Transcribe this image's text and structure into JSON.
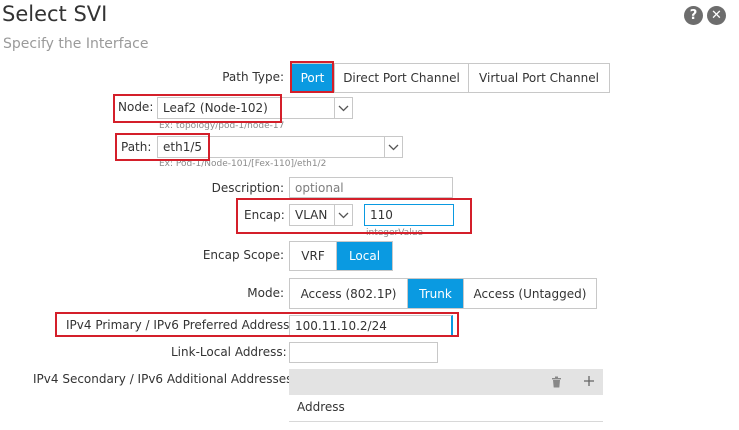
{
  "header": {
    "title": "Select SVI",
    "subtitle": "Specify the Interface",
    "help_glyph": "?",
    "close_glyph": "✕"
  },
  "form": {
    "path_type": {
      "label": "Path Type:",
      "options": [
        "Port",
        "Direct Port Channel",
        "Virtual Port Channel"
      ],
      "selected": "Port"
    },
    "node": {
      "label": "Node:",
      "value": "Leaf2 (Node-102)",
      "hint": "Ex: topology/pod-1/node-17"
    },
    "path": {
      "label": "Path:",
      "value": "eth1/5",
      "hint": "Ex: Pod-1/Node-101/[Fex-110]/eth1/2"
    },
    "description": {
      "label": "Description:",
      "placeholder": "optional"
    },
    "encap": {
      "label": "Encap:",
      "type": "VLAN",
      "value": "110",
      "hint": "integerValue"
    },
    "encap_scope": {
      "label": "Encap Scope:",
      "options": [
        "VRF",
        "Local"
      ],
      "selected": "Local"
    },
    "mode": {
      "label": "Mode:",
      "options": [
        "Access (802.1P)",
        "Trunk",
        "Access (Untagged)"
      ],
      "selected": "Trunk"
    },
    "ipv4_primary": {
      "label": "IPv4 Primary / IPv6 Preferred Address:",
      "value": "100.11.10.2/24"
    },
    "link_local": {
      "label": "Link-Local Address:",
      "value": ""
    },
    "secondary": {
      "label": "IPv4 Secondary / IPv6 Additional Addresses:",
      "column": "Address"
    }
  },
  "colors": {
    "accent": "#0a9ae1",
    "highlight": "#d41f2a",
    "toolbar": "#e3e3e3"
  },
  "icons": {
    "chevron": "chevron-down-icon",
    "trash": "trash-icon",
    "add": "plus-icon"
  }
}
